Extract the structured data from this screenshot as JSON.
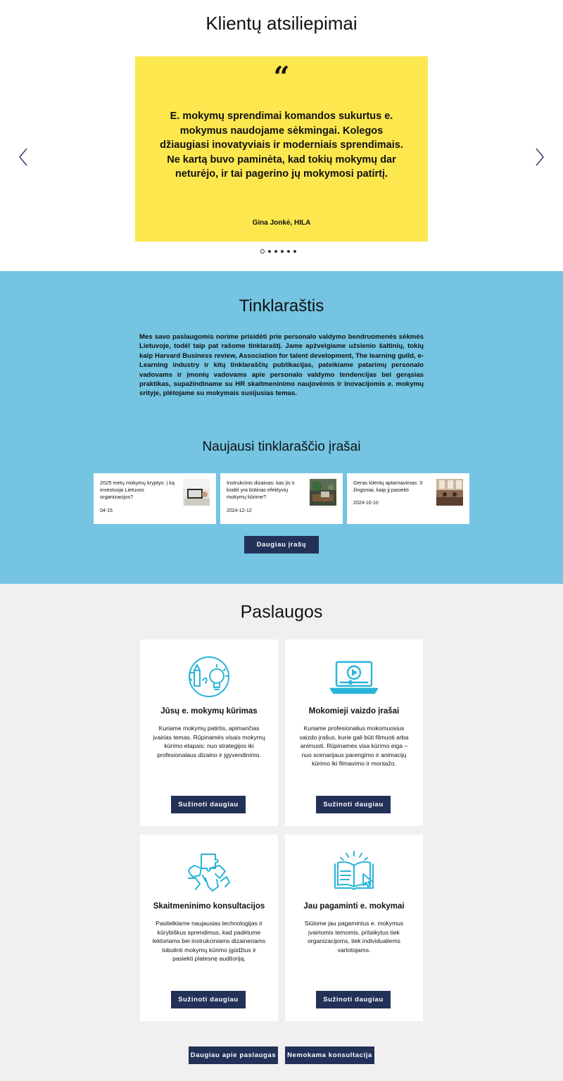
{
  "testimonials": {
    "title": "Klientų atsiliepimai",
    "quote_mark": "“",
    "text": "E. mokymų sprendimai komandos sukurtus e. mokymus naudojame sėkmingai. Kolegos džiaugiasi inovatyviais ir moderniais sprendimais. Ne kartą buvo paminėta, kad tokių mokymų dar neturėjo, ir tai pagerino jų mokymosi patirtį.",
    "author": "Gina Jonkė, HILA",
    "card_color": "#fde74f",
    "slide_count": 6,
    "active_slide": 1
  },
  "blog": {
    "title": "Tinklaraštis",
    "description": "Mes savo paslaugomis norime prisidėti prie personalo valdymo bendruomenės sėkmės Lietuvoje, todėl taip pat rašome tinklaraštį. Jame apžvelgiame užsienio šaltinių, tokių kaip Harvard Business review, Association for talent development, The learning guild, e-Learning industry ir kitų tinklaraščių publikacijas, pateikiame patarimų personalo vadovams ir įmonių vadovams apie personalo valdymo tendencijas bei gerąsias praktikas, supažindiname su HR skaitmeninimo naujovėmis ir inovacijomis e. mokymų srityje, plėtojame su mokymais susijusias temas.",
    "latest_title": "Naujausi tinklaraščio įrašai",
    "background": "#74c4e2",
    "posts": [
      {
        "title": "2025 metų mokymų kryptys: į ką investuoja Lietuvos organizacijos?",
        "date": "04-15"
      },
      {
        "title": "Instrukcinis dizainas: kas jis ir kodėl yra būtinas efektyvių mokymų kūrime?",
        "date": "2024-12-12"
      },
      {
        "title": "Geras klientų aptarnavimas: 3 žingsniai, kaip jį pasiekti",
        "date": "2024-10-10"
      }
    ],
    "more_button": "Daugiau įrašų"
  },
  "services": {
    "title": "Paslaugos",
    "icon_color": "#29b5d8",
    "button_color": "#233158",
    "cards": [
      {
        "icon": "brain-lightbulb-icon",
        "title": "Jūsų e. mokymų kūrimas",
        "text": "Kuriame mokymų patirtis, apimančias įvairias temas. Rūpinamės visais mokymų kūrimo etapais: nuo strategijos iki profesionalaus dizaino ir įgyvendinimo.",
        "button": "Sužinoti daugiau"
      },
      {
        "icon": "video-laptop-icon",
        "title": "Mokomieji vaizdo įrašai",
        "text": "Kuriame profesionalius mokomuosius vaizdo įrašus, kurie gali būti filmuoti arba animuoti. Rūpinamės visa kūrimo eiga – nuo scenarijaus parengimo ir animacijų kūrimo iki filmavimo ir montažo.",
        "button": "Sužinoti daugiau"
      },
      {
        "icon": "puzzle-hands-icon",
        "title": "Skaitmeninimo konsultacijos",
        "text": "Pasitelkiame naujausias technologijas ir kūrybiškus sprendimus, kad padėtume lektoriams bei instrukciniams dizaineriams tobulinti mokymų kūrimo įgūdžius ir pasiekti platesnę auditoriją.",
        "button": "Sužinoti daugiau"
      },
      {
        "icon": "open-book-cursor-icon",
        "title": "Jau pagaminti e. mokymai",
        "text": "Siūlome jau pagamintus e. mokymus įvairiomis temomis, pritaikytus tiek organizacijoms, tiek individualiems vartotojams.",
        "button": "Sužinoti daugiau"
      }
    ],
    "bottom_buttons": [
      "Daugiau apie paslaugas",
      "Nemokama konsultacija"
    ]
  }
}
